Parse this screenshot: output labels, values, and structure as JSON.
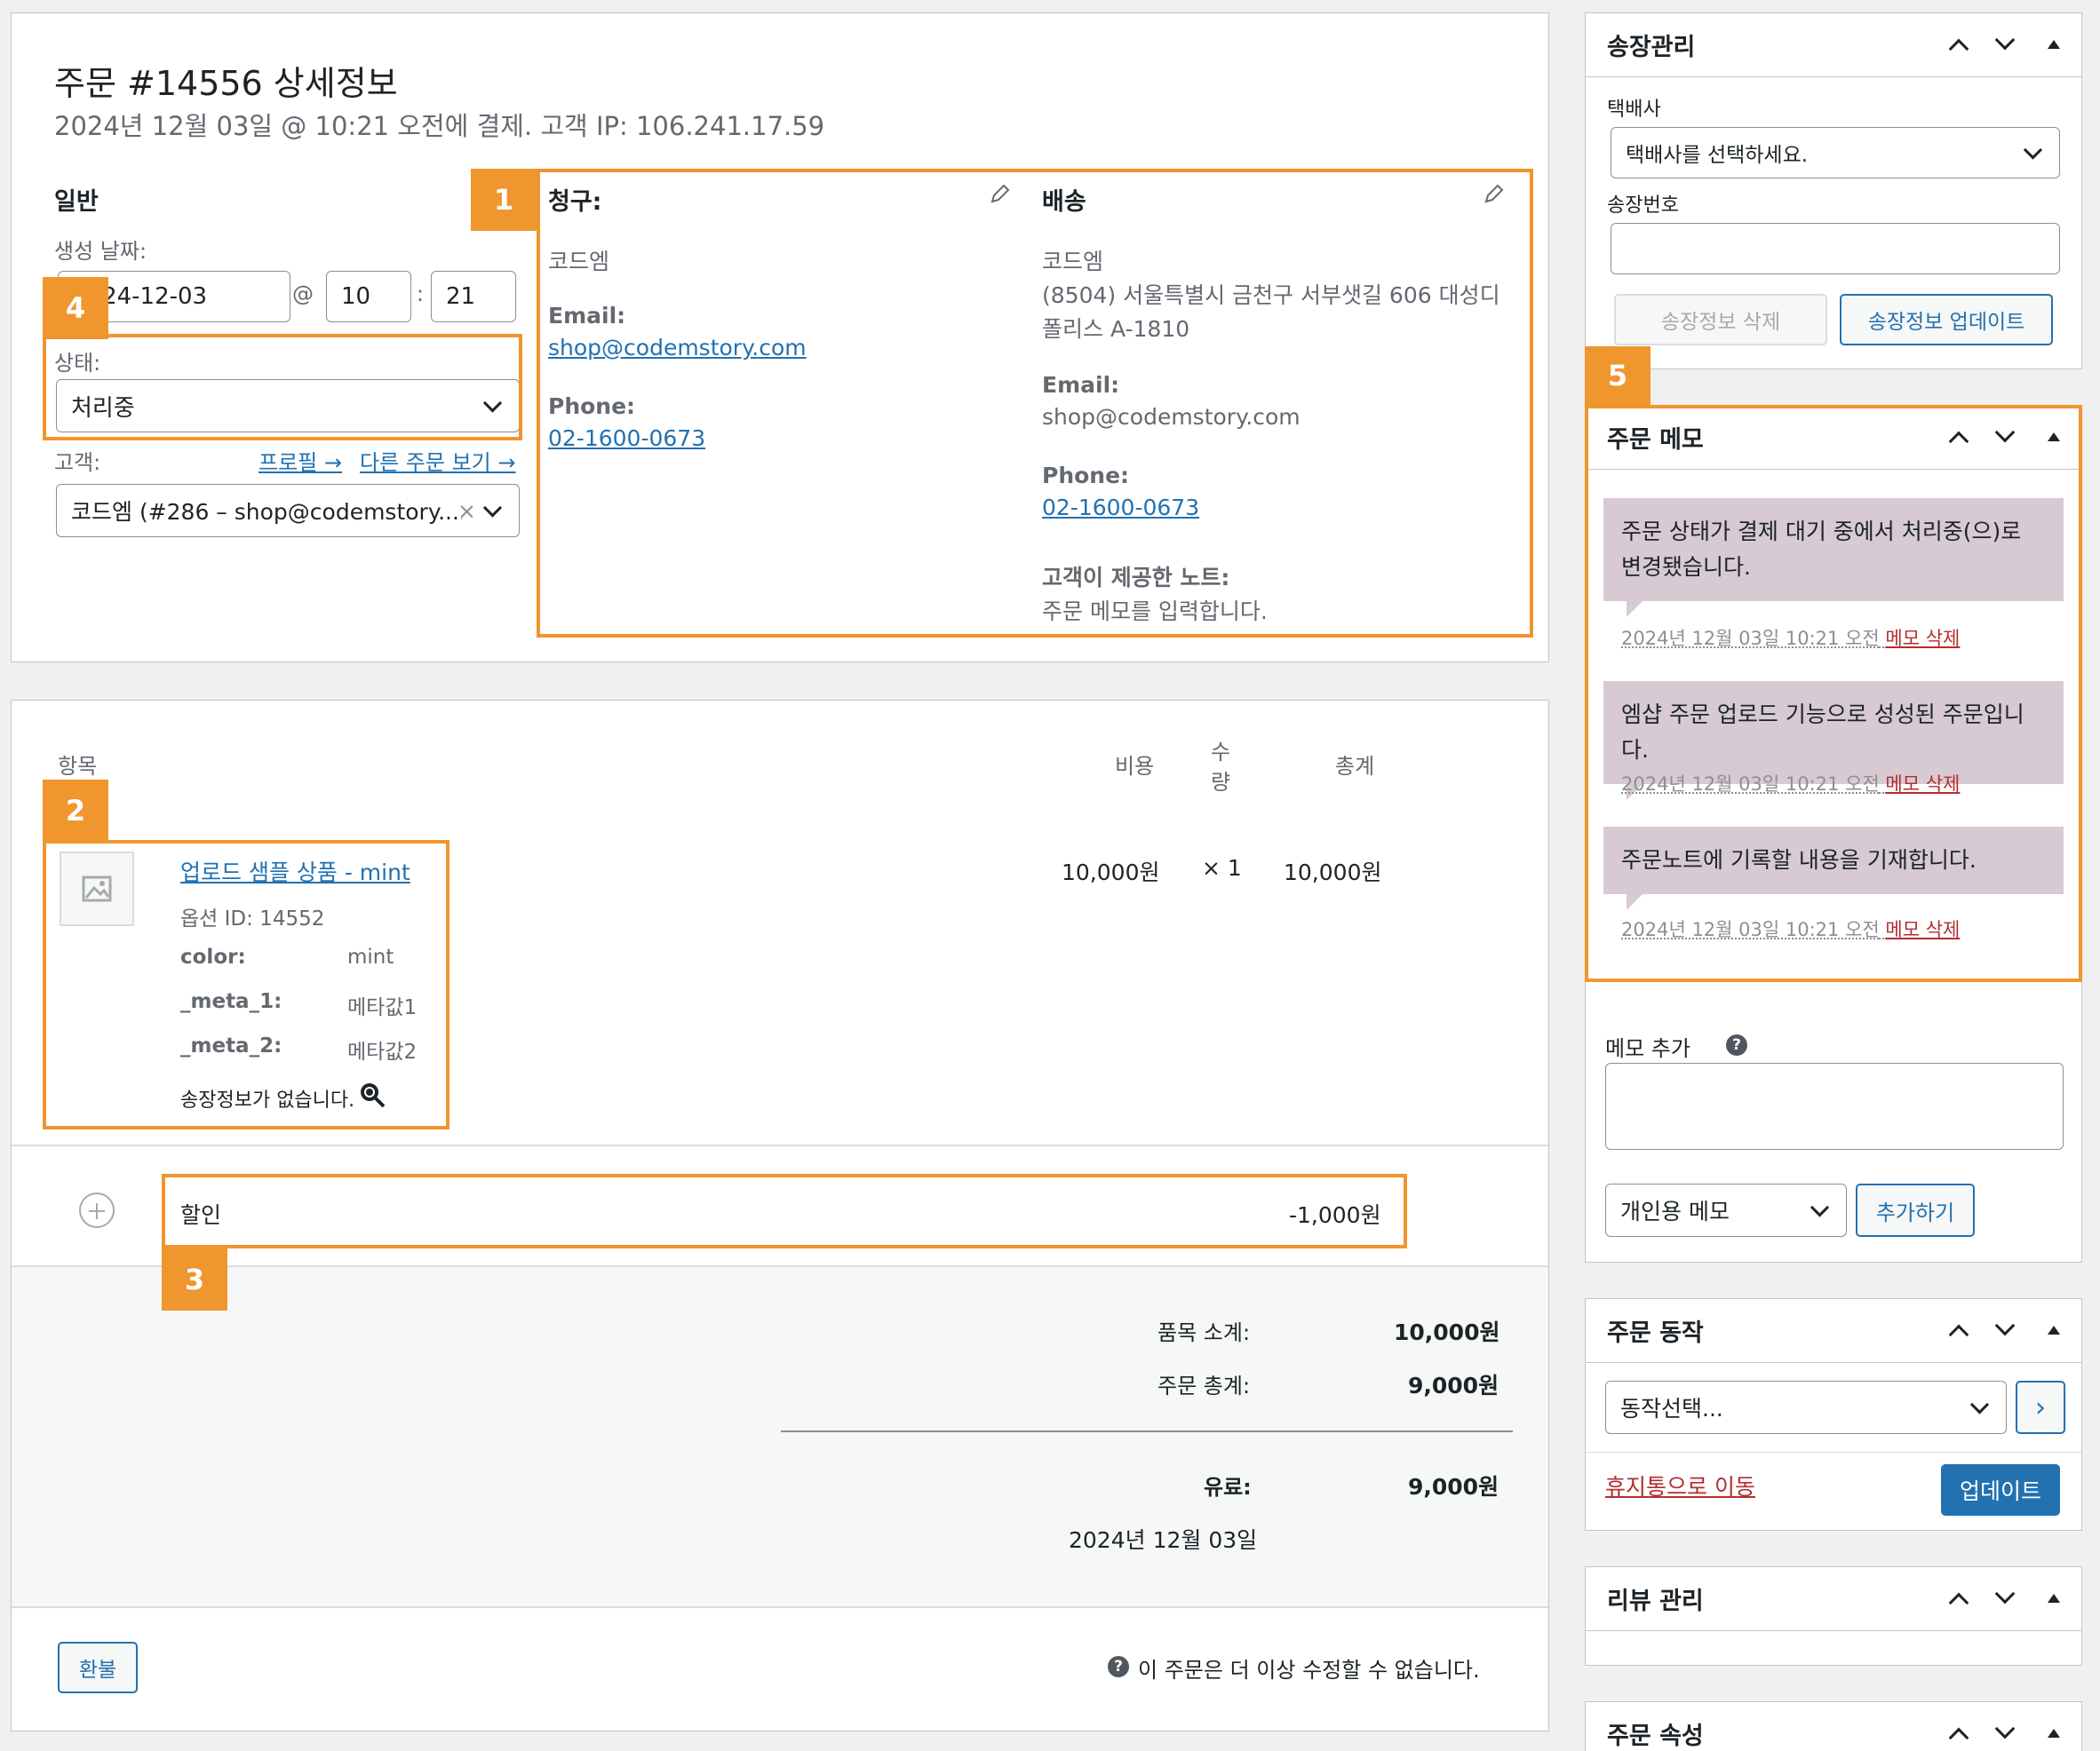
{
  "order": {
    "title": "주문 #14556 상세정보",
    "subtitle": "2024년 12월 03일 @ 10:21 오전에 결제. 고객 IP: 106.241.17.59"
  },
  "general": {
    "heading": "일반",
    "created_label": "생성 날짜:",
    "date_value": "2024-12-03",
    "at": "@",
    "hour": "10",
    "colon": ":",
    "minute": "21",
    "status_label": "상태:",
    "status_value": "처리중",
    "customer_label": "고객:",
    "profile_link": "프로필 →",
    "other_orders_link": "다른 주문 보기 →",
    "customer_value": "코드엠 (#286 – shop@codemstory....",
    "clear": "×"
  },
  "billing": {
    "heading": "청구:",
    "name": "코드엠",
    "email_label": "Email:",
    "email": "shop@codemstory.com",
    "phone_label": "Phone:",
    "phone": "02-1600-0673"
  },
  "shipping": {
    "heading": "배송",
    "name": "코드엠",
    "address_line1": "(8504) 서울특별시 금천구 서부샛길 606 대성디",
    "address_line2": "폴리스 A-1810",
    "email_label": "Email:",
    "email": "shop@codemstory.com",
    "phone_label": "Phone:",
    "phone": "02-1600-0673",
    "note_label": "고객이 제공한 노트:",
    "note": "주문 메모를 입력합니다."
  },
  "items": {
    "col_item": "항목",
    "col_cost": "비용",
    "col_qty_1": "수",
    "col_qty_2": "량",
    "col_total": "총계",
    "rows": [
      {
        "name": "업로드 샘플 상품 - mint",
        "option_id": "옵션 ID: 14552",
        "meta": [
          {
            "key": "color:",
            "value": "mint"
          },
          {
            "key": "_meta_1:",
            "value": "메타값1"
          },
          {
            "key": "_meta_2:",
            "value": "메타값2"
          }
        ],
        "shipping_info": "송장정보가 없습니다.",
        "cost": "10,000원",
        "qty": "× 1",
        "total": "10,000원"
      }
    ],
    "discount_label": "할인",
    "discount_value": "-1,000원"
  },
  "totals": {
    "subtotal_label": "품목 소계:",
    "subtotal": "10,000원",
    "order_total_label": "주문 총계:",
    "order_total": "9,000원",
    "paid_label": "유료:",
    "paid": "9,000원",
    "paid_date": "2024년 12월 03일",
    "refund_button": "환불",
    "locked_notice": "이 주문은 더 이상 수정할 수 없습니다."
  },
  "tracking": {
    "title": "송장관리",
    "carrier_label": "택배사",
    "carrier_placeholder": "택배사를 선택하세요.",
    "number_label": "송장번호",
    "number_value": "",
    "delete_button": "송장정보 삭제",
    "update_button": "송장정보 업데이트"
  },
  "notes": {
    "title": "주문 메모",
    "list": [
      {
        "text": "주문 상태가 결제 대기 중에서 처리중(으)로 변경됐습니다.",
        "date": "2024년 12월 03일 10:21 오전",
        "delete": "메모 삭제"
      },
      {
        "text": "엠샵 주문 업로드 기능으로 성성된 주문입니다.",
        "date": "2024년 12월 03일 10:21 오전",
        "delete": "메모 삭제"
      },
      {
        "text": "주문노트에 기록할 내용을 기재합니다.",
        "date": "2024년 12월 03일 10:21 오전",
        "delete": "메모 삭제"
      }
    ],
    "add_label": "메모 추가",
    "add_value": "",
    "type_value": "개인용 메모",
    "add_button": "추가하기"
  },
  "actions": {
    "title": "주문 동작",
    "select_value": "동작선택...",
    "go": "›",
    "trash_link": "휴지통으로 이동",
    "update_button": "업데이트"
  },
  "reviews": {
    "title": "리뷰 관리"
  },
  "attributes": {
    "title": "주문 속성"
  },
  "annotations": {
    "b1": "1",
    "b2": "2",
    "b3": "3",
    "b4": "4",
    "b5": "5"
  },
  "colors": {
    "accent": "#f0962e",
    "link": "#2271b1",
    "note_bg": "#d7cad2",
    "danger": "#b32d2e"
  }
}
